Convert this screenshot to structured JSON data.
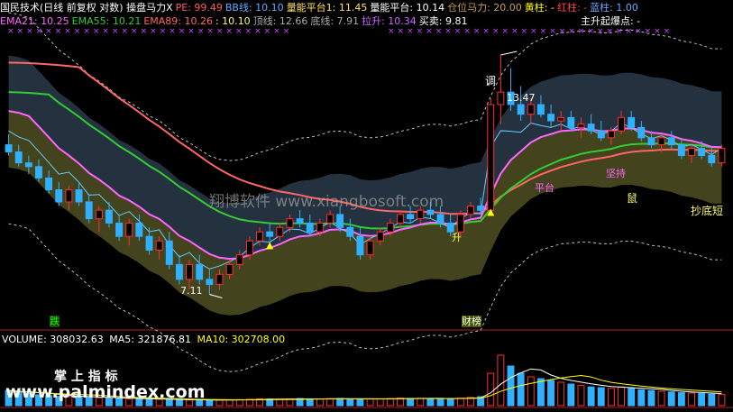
{
  "header_line1": [
    {
      "text": "国民技术(日线 前复权 对数) 操盘马力X",
      "color": "#ffffff"
    },
    {
      "text": "PE: 99.49",
      "color": "#ff5a5a"
    },
    {
      "text": "BB线: 10.10",
      "color": "#66aaff"
    },
    {
      "text": "量能平台1: 11.45",
      "color": "#ffe066"
    },
    {
      "text": "量能平台: 10.14",
      "color": "#ffffff"
    },
    {
      "text": "仓位马力: 20.00",
      "color": "#c8a050"
    },
    {
      "text": "黄柱: -",
      "color": "#ffff00"
    },
    {
      "text": "红柱: -",
      "color": "#ff4040"
    },
    {
      "text": "蓝柱: 1.00",
      "color": "#66aaff"
    }
  ],
  "header_line2": [
    {
      "text": "EMA21: 10.25",
      "color": "#ff66ff"
    },
    {
      "text": "EMA55: 10.21",
      "color": "#33cc33"
    },
    {
      "text": "EMA89: 10.26",
      "color": "#ff6666"
    },
    {
      "text": ": 10.10",
      "color": "#ffff66"
    },
    {
      "text": "顶线: 12.66",
      "color": "#aaaaaa"
    },
    {
      "text": "底线: 7.91",
      "color": "#aaaaaa"
    },
    {
      "text": "拉升: 10.34",
      "color": "#cc66ff"
    },
    {
      "text": "买卖: 9.81",
      "color": "#ffffff"
    }
  ],
  "header_line3": "主升起爆点: -",
  "x_markers": "××××××××××××××××××××××××××××××",
  "watermark": "翔博软件 www.xiangbosoft.com",
  "annotations": {
    "high_label": "13.47",
    "low_label": "7.11",
    "diao": "调",
    "sheng": "升",
    "mou_zhu": "鼠",
    "pingtai": "平台",
    "bottom_buy": "抄底短",
    "xi_wang": "坚持",
    "die": "跌",
    "caibang": "财榜"
  },
  "volume_header": {
    "volume": "VOLUME: 308032.63",
    "ma5": "MA5: 321876.81",
    "ma10": "MA10: 302708.00"
  },
  "bottom_watermark_cn": "掌 上 指 标",
  "bottom_watermark_url": "www.palmindex.com",
  "colors": {
    "up": "#ff3030",
    "down": "#30b0ff",
    "ema21": "#ff66ff",
    "ema55": "#33cc33",
    "ema89": "#ff6666",
    "band": "#4a4a20",
    "upper_band": "#2a3a4a"
  },
  "chart_data": {
    "type": "candlestick",
    "price_range": [
      6.8,
      14.0
    ],
    "candles": [
      {
        "o": 10.6,
        "h": 10.9,
        "l": 10.3,
        "c": 10.4
      },
      {
        "o": 10.4,
        "h": 10.6,
        "l": 10.0,
        "c": 10.1
      },
      {
        "o": 10.1,
        "h": 10.3,
        "l": 9.8,
        "c": 10.0
      },
      {
        "o": 10.0,
        "h": 10.2,
        "l": 9.6,
        "c": 9.7
      },
      {
        "o": 9.7,
        "h": 9.9,
        "l": 9.3,
        "c": 9.4
      },
      {
        "o": 9.4,
        "h": 9.6,
        "l": 9.0,
        "c": 9.1
      },
      {
        "o": 9.1,
        "h": 9.5,
        "l": 8.9,
        "c": 9.4
      },
      {
        "o": 9.4,
        "h": 9.6,
        "l": 9.0,
        "c": 9.1
      },
      {
        "o": 9.1,
        "h": 9.3,
        "l": 8.6,
        "c": 8.7
      },
      {
        "o": 8.7,
        "h": 9.0,
        "l": 8.4,
        "c": 8.9
      },
      {
        "o": 8.9,
        "h": 9.1,
        "l": 8.5,
        "c": 8.6
      },
      {
        "o": 8.6,
        "h": 8.8,
        "l": 8.2,
        "c": 8.3
      },
      {
        "o": 8.3,
        "h": 8.7,
        "l": 8.1,
        "c": 8.6
      },
      {
        "o": 8.6,
        "h": 8.8,
        "l": 8.2,
        "c": 8.3
      },
      {
        "o": 8.3,
        "h": 8.5,
        "l": 7.9,
        "c": 8.0
      },
      {
        "o": 8.0,
        "h": 8.3,
        "l": 7.8,
        "c": 8.2
      },
      {
        "o": 8.2,
        "h": 8.4,
        "l": 7.6,
        "c": 7.7
      },
      {
        "o": 7.7,
        "h": 7.9,
        "l": 7.3,
        "c": 7.4
      },
      {
        "o": 7.4,
        "h": 7.8,
        "l": 7.2,
        "c": 7.7
      },
      {
        "o": 7.7,
        "h": 7.9,
        "l": 7.3,
        "c": 7.4
      },
      {
        "o": 7.4,
        "h": 7.6,
        "l": 7.11,
        "c": 7.3
      },
      {
        "o": 7.3,
        "h": 7.6,
        "l": 7.2,
        "c": 7.5
      },
      {
        "o": 7.5,
        "h": 7.8,
        "l": 7.4,
        "c": 7.7
      },
      {
        "o": 7.7,
        "h": 8.0,
        "l": 7.6,
        "c": 7.9
      },
      {
        "o": 7.9,
        "h": 8.3,
        "l": 7.8,
        "c": 8.2
      },
      {
        "o": 8.2,
        "h": 8.5,
        "l": 8.1,
        "c": 8.4
      },
      {
        "o": 8.4,
        "h": 8.6,
        "l": 8.2,
        "c": 8.3
      },
      {
        "o": 8.3,
        "h": 8.6,
        "l": 8.2,
        "c": 8.5
      },
      {
        "o": 8.5,
        "h": 8.8,
        "l": 8.4,
        "c": 8.7
      },
      {
        "o": 8.7,
        "h": 8.9,
        "l": 8.5,
        "c": 8.6
      },
      {
        "o": 8.6,
        "h": 8.8,
        "l": 8.3,
        "c": 8.4
      },
      {
        "o": 8.4,
        "h": 8.7,
        "l": 8.3,
        "c": 8.6
      },
      {
        "o": 8.6,
        "h": 8.9,
        "l": 8.5,
        "c": 8.8
      },
      {
        "o": 8.8,
        "h": 9.0,
        "l": 8.4,
        "c": 8.5
      },
      {
        "o": 8.5,
        "h": 8.7,
        "l": 8.2,
        "c": 8.3
      },
      {
        "o": 8.3,
        "h": 8.5,
        "l": 7.8,
        "c": 7.9
      },
      {
        "o": 7.9,
        "h": 8.3,
        "l": 7.8,
        "c": 8.2
      },
      {
        "o": 8.2,
        "h": 8.5,
        "l": 8.1,
        "c": 8.4
      },
      {
        "o": 8.4,
        "h": 8.7,
        "l": 8.3,
        "c": 8.6
      },
      {
        "o": 8.6,
        "h": 8.9,
        "l": 8.5,
        "c": 8.8
      },
      {
        "o": 8.8,
        "h": 9.0,
        "l": 8.6,
        "c": 8.7
      },
      {
        "o": 8.7,
        "h": 9.0,
        "l": 8.6,
        "c": 8.9
      },
      {
        "o": 8.9,
        "h": 9.1,
        "l": 8.7,
        "c": 8.8
      },
      {
        "o": 8.8,
        "h": 9.0,
        "l": 8.5,
        "c": 8.6
      },
      {
        "o": 8.6,
        "h": 8.8,
        "l": 8.3,
        "c": 8.4
      },
      {
        "o": 8.4,
        "h": 8.9,
        "l": 8.3,
        "c": 8.8
      },
      {
        "o": 8.8,
        "h": 9.1,
        "l": 8.7,
        "c": 9.0
      },
      {
        "o": 9.0,
        "h": 9.2,
        "l": 8.8,
        "c": 8.9
      },
      {
        "o": 8.9,
        "h": 12.0,
        "l": 8.9,
        "c": 11.8
      },
      {
        "o": 11.8,
        "h": 13.47,
        "l": 11.2,
        "c": 12.2
      },
      {
        "o": 12.2,
        "h": 13.0,
        "l": 11.6,
        "c": 11.8
      },
      {
        "o": 11.8,
        "h": 12.4,
        "l": 11.3,
        "c": 11.5
      },
      {
        "o": 11.5,
        "h": 12.0,
        "l": 11.2,
        "c": 11.8
      },
      {
        "o": 11.8,
        "h": 12.1,
        "l": 11.4,
        "c": 11.5
      },
      {
        "o": 11.5,
        "h": 11.8,
        "l": 11.1,
        "c": 11.3
      },
      {
        "o": 11.3,
        "h": 11.6,
        "l": 11.0,
        "c": 11.4
      },
      {
        "o": 11.4,
        "h": 11.6,
        "l": 11.0,
        "c": 11.1
      },
      {
        "o": 11.1,
        "h": 11.4,
        "l": 10.8,
        "c": 11.2
      },
      {
        "o": 11.2,
        "h": 11.5,
        "l": 10.9,
        "c": 11.0
      },
      {
        "o": 11.0,
        "h": 11.3,
        "l": 10.7,
        "c": 10.8
      },
      {
        "o": 10.8,
        "h": 11.1,
        "l": 10.6,
        "c": 11.0
      },
      {
        "o": 11.0,
        "h": 11.6,
        "l": 10.9,
        "c": 11.4
      },
      {
        "o": 11.4,
        "h": 11.6,
        "l": 11.0,
        "c": 11.1
      },
      {
        "o": 11.1,
        "h": 11.3,
        "l": 10.7,
        "c": 10.8
      },
      {
        "o": 10.8,
        "h": 11.0,
        "l": 10.5,
        "c": 10.6
      },
      {
        "o": 10.6,
        "h": 10.9,
        "l": 10.4,
        "c": 10.8
      },
      {
        "o": 10.8,
        "h": 11.0,
        "l": 10.5,
        "c": 10.6
      },
      {
        "o": 10.6,
        "h": 10.8,
        "l": 10.2,
        "c": 10.3
      },
      {
        "o": 10.3,
        "h": 10.6,
        "l": 10.1,
        "c": 10.5
      },
      {
        "o": 10.5,
        "h": 10.7,
        "l": 10.2,
        "c": 10.3
      },
      {
        "o": 10.3,
        "h": 10.5,
        "l": 10.0,
        "c": 10.1
      },
      {
        "o": 10.1,
        "h": 10.6,
        "l": 10.0,
        "c": 10.5
      }
    ],
    "volume_range": [
      0,
      1600000
    ],
    "volume": [
      420000,
      380000,
      350000,
      300000,
      280000,
      260000,
      250000,
      240000,
      230000,
      220000,
      210000,
      200000,
      190000,
      185000,
      180000,
      175000,
      170000,
      165000,
      160000,
      155000,
      150000,
      155000,
      160000,
      170000,
      180000,
      190000,
      185000,
      180000,
      190000,
      200000,
      190000,
      185000,
      195000,
      200000,
      190000,
      180000,
      185000,
      190000,
      200000,
      210000,
      200000,
      205000,
      200000,
      195000,
      190000,
      210000,
      230000,
      250000,
      900000,
      1400000,
      1100000,
      900000,
      800000,
      750000,
      700000,
      650000,
      600000,
      560000,
      520000,
      500000,
      480000,
      520000,
      480000,
      440000,
      420000,
      400000,
      380000,
      360000,
      350000,
      340000,
      320000,
      308032
    ]
  }
}
